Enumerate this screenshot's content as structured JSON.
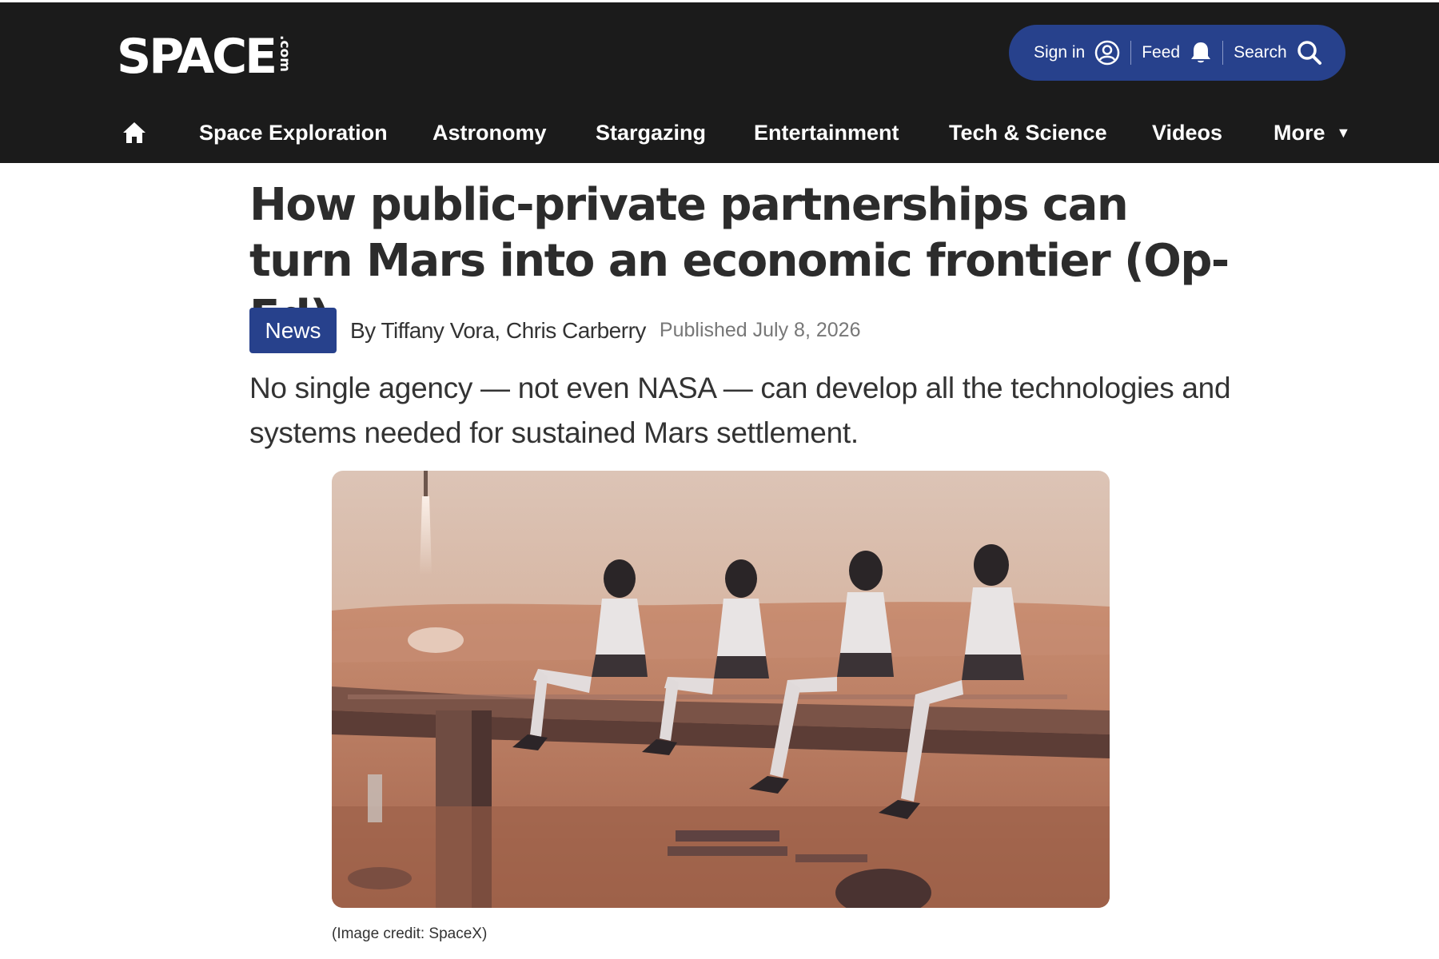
{
  "site": {
    "logo_main": "SPACE",
    "logo_suffix": ".com"
  },
  "utility": {
    "sign_in": "Sign in",
    "feed": "Feed",
    "search": "Search"
  },
  "nav": {
    "items": [
      {
        "label": "Space Exploration"
      },
      {
        "label": "Astronomy"
      },
      {
        "label": "Stargazing"
      },
      {
        "label": "Entertainment"
      },
      {
        "label": "Tech & Science"
      },
      {
        "label": "Videos"
      },
      {
        "label": "More"
      }
    ]
  },
  "article": {
    "headline": "How public-private partnerships can turn Mars into an economic frontier (Op-Ed)",
    "category": "News",
    "byline": "By Tiffany Vora, Chris Carberry",
    "published": "Published July 8, 2026",
    "standfirst": "No single agency — not even NASA — can develop all the technologies and systems needed for sustained Mars settlement.",
    "image_credit": "(Image credit: SpaceX)"
  },
  "icons": {
    "home": "home-icon",
    "user": "user-circle-icon",
    "bell": "bell-icon",
    "search": "search-icon",
    "caret": "caret-down-icon"
  },
  "colors": {
    "header_bg": "#1b1b1b",
    "accent_blue": "#27418c"
  }
}
